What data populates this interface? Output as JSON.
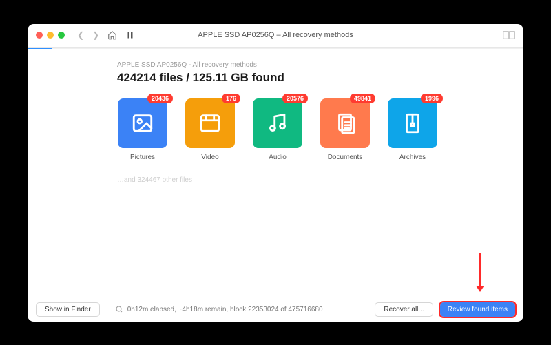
{
  "window": {
    "title": "APPLE SSD AP0256Q – All recovery methods"
  },
  "progress": {
    "subhead": "APPLE SSD AP0256Q - All recovery methods",
    "headline": "424214 files / 125.11 GB found"
  },
  "categories": [
    {
      "label": "Pictures",
      "count": "20436",
      "color": "#3b82f6",
      "icon": "image"
    },
    {
      "label": "Video",
      "count": "176",
      "color": "#f59e0b",
      "icon": "video"
    },
    {
      "label": "Audio",
      "count": "20576",
      "color": "#10b981",
      "icon": "audio"
    },
    {
      "label": "Documents",
      "count": "49841",
      "color": "#ff7a4d",
      "icon": "document"
    },
    {
      "label": "Archives",
      "count": "1996",
      "color": "#0ea5e9",
      "icon": "archive"
    }
  ],
  "other_files_text": "…and 324467 other files",
  "footer": {
    "show_in_finder": "Show in Finder",
    "status": "0h12m elapsed, ~4h18m remain, block 22353024 of 475716680",
    "recover_all": "Recover all...",
    "review": "Review found items"
  }
}
